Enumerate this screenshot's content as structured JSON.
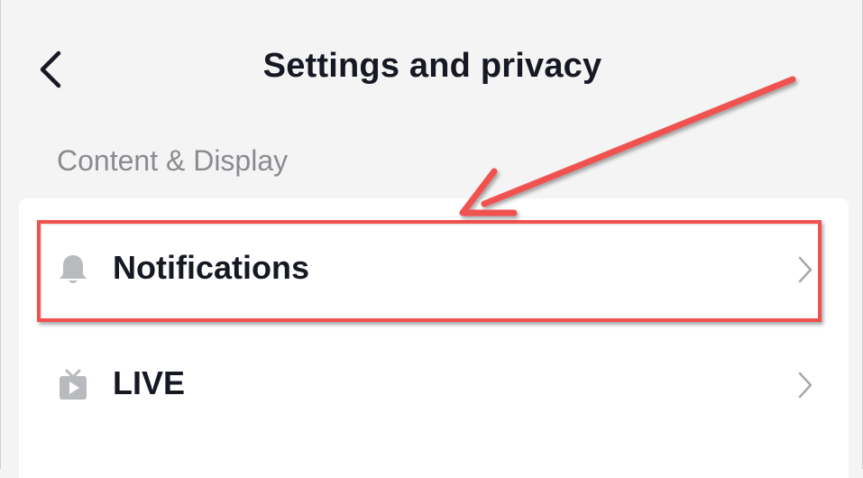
{
  "header": {
    "title": "Settings and privacy",
    "back_icon": "chevron-left-icon"
  },
  "section": {
    "label": "Content & Display"
  },
  "items": [
    {
      "label": "Notifications",
      "icon": "bell-icon"
    },
    {
      "label": "LIVE",
      "icon": "live-tv-icon"
    }
  ],
  "colors": {
    "background": "#f4f4f4",
    "card": "#ffffff",
    "text_primary": "#161823",
    "text_secondary": "#8a8b91",
    "icon_gray": "#b9babe",
    "annotation_red": "#f0524f"
  }
}
